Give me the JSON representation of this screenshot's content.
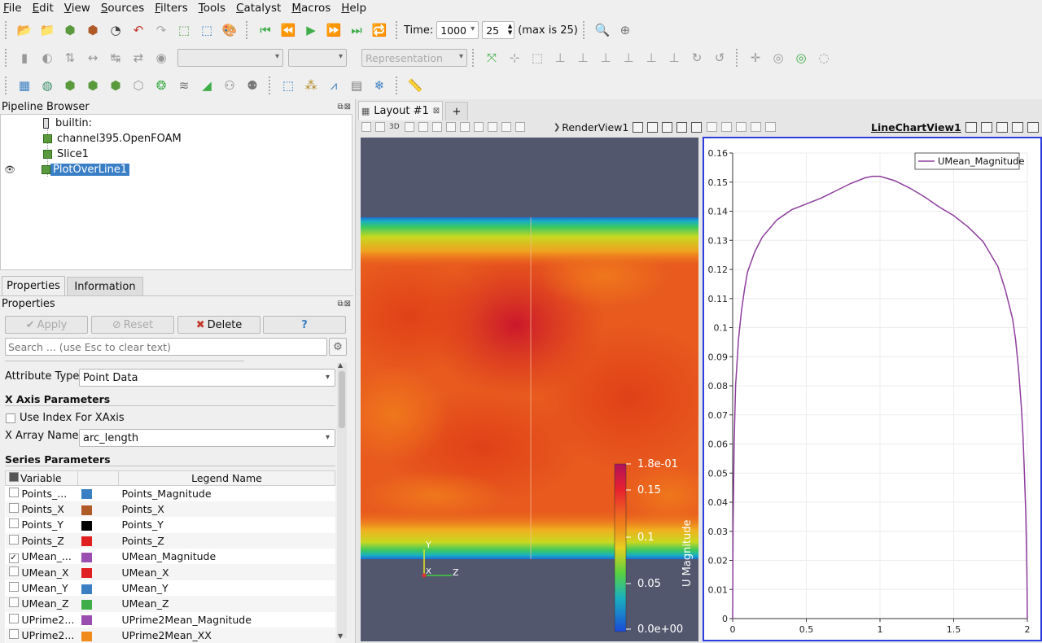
{
  "menu": [
    "File",
    "Edit",
    "View",
    "Sources",
    "Filters",
    "Tools",
    "Catalyst",
    "Macros",
    "Help"
  ],
  "toolbar": {
    "time_label": "Time:",
    "time_value": "1000",
    "timestep_value": "25",
    "max_note": "(max is 25)",
    "representation_placeholder": "Representation"
  },
  "pipeline": {
    "title": "Pipeline Browser",
    "items": [
      {
        "label": "builtin:"
      },
      {
        "label": "channel395.OpenFOAM"
      },
      {
        "label": "Slice1"
      },
      {
        "label": "PlotOverLine1",
        "selected": true
      }
    ]
  },
  "tabs": {
    "properties": "Properties",
    "information": "Information"
  },
  "properties": {
    "title": "Properties",
    "apply_label": "Apply",
    "reset_label": "Reset",
    "delete_label": "Delete",
    "help_label": "?",
    "search_placeholder": "Search ... (use Esc to clear text)",
    "attribute_type_label": "Attribute Type",
    "attribute_type_value": "Point Data",
    "x_axis_header": "X Axis Parameters",
    "use_index_label": "Use Index For XAxis",
    "x_array_label": "X Array Name",
    "x_array_value": "arc_length",
    "series_header": "Series Parameters",
    "col_variable": "Variable",
    "col_legend": "Legend Name",
    "series": [
      {
        "variable": "Points_...",
        "color": "#3a7fc1",
        "legend": "Points_Magnitude",
        "checked": false
      },
      {
        "variable": "Points_X",
        "color": "#b05a28",
        "legend": "Points_X",
        "checked": false
      },
      {
        "variable": "Points_Y",
        "color": "#000000",
        "legend": "Points_Y",
        "checked": false
      },
      {
        "variable": "Points_Z",
        "color": "#e02020",
        "legend": "Points_Z",
        "checked": false
      },
      {
        "variable": "UMean_...",
        "color": "#9a4fb0",
        "legend": "UMean_Magnitude",
        "checked": true
      },
      {
        "variable": "UMean_X",
        "color": "#e02020",
        "legend": "UMean_X",
        "checked": false
      },
      {
        "variable": "UMean_Y",
        "color": "#3a7fc1",
        "legend": "UMean_Y",
        "checked": false
      },
      {
        "variable": "UMean_Z",
        "color": "#3fae49",
        "legend": "UMean_Z",
        "checked": false
      },
      {
        "variable": "UPrime2...",
        "color": "#9a4fb0",
        "legend": "UPrime2Mean_Magnitude",
        "checked": false
      },
      {
        "variable": "UPrime2...",
        "color": "#f08a1a",
        "legend": "UPrime2Mean_XX",
        "checked": false
      }
    ]
  },
  "layout": {
    "tab_label": "Layout #1",
    "add_label": "+"
  },
  "render_view": {
    "title": "RenderView1",
    "btn_3d": "3D",
    "colorbar_title": "U Magnitude",
    "colorbar_ticks": [
      "1.8e-01",
      "0.15",
      "0.1",
      "0.05",
      "0.0e+00"
    ],
    "axis_y": "Y",
    "axis_x": "X",
    "axis_z": "Z"
  },
  "chart_view": {
    "title": "LineChartView1"
  },
  "chart_data": {
    "type": "line",
    "legend_placement": "top-right",
    "xlim": [
      0,
      2
    ],
    "ylim": [
      0,
      0.16
    ],
    "x_ticks": [
      "0",
      "0.5",
      "1",
      "1.5",
      "2"
    ],
    "y_ticks": [
      "0",
      "0.01",
      "0.02",
      "0.03",
      "0.04",
      "0.05",
      "0.06",
      "0.07",
      "0.08",
      "0.09",
      "0.1",
      "0.11",
      "0.12",
      "0.13",
      "0.14",
      "0.15",
      "0.16"
    ],
    "grid": true,
    "series": [
      {
        "name": "UMean_Magnitude",
        "color": "#8e3e9c",
        "x": [
          0,
          0.003,
          0.01,
          0.02,
          0.04,
          0.06,
          0.08,
          0.1,
          0.15,
          0.2,
          0.3,
          0.4,
          0.5,
          0.6,
          0.7,
          0.8,
          0.9,
          0.95,
          1.0,
          1.1,
          1.2,
          1.3,
          1.4,
          1.5,
          1.6,
          1.7,
          1.8,
          1.85,
          1.9,
          1.92,
          1.94,
          1.96,
          1.97,
          1.98,
          1.99,
          1.997,
          2.0
        ],
        "y": [
          0,
          0.03,
          0.06,
          0.08,
          0.096,
          0.106,
          0.113,
          0.119,
          0.126,
          0.131,
          0.137,
          0.1405,
          0.1425,
          0.1445,
          0.147,
          0.1495,
          0.1515,
          0.152,
          0.152,
          0.1505,
          0.148,
          0.145,
          0.1415,
          0.1385,
          0.1345,
          0.1295,
          0.121,
          0.113,
          0.103,
          0.096,
          0.086,
          0.072,
          0.063,
          0.05,
          0.035,
          0.015,
          0
        ]
      }
    ]
  }
}
